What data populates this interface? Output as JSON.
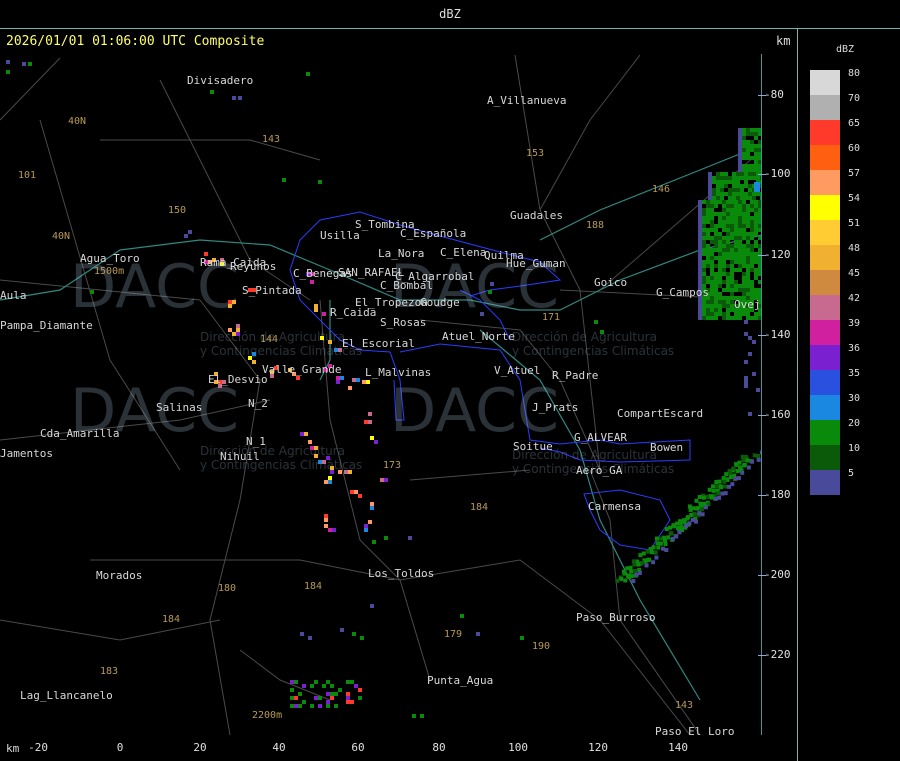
{
  "window_title": "dBZ",
  "header": "2026/01/01 01:06:00 UTC Composite",
  "unit_top": "km",
  "unit_bottom": "km",
  "y_ticks": [
    "-80",
    "-100",
    "-120",
    "-140",
    "-160",
    "-180",
    "-200",
    "-220"
  ],
  "x_ticks": [
    "-20",
    "0",
    "20",
    "40",
    "60",
    "80",
    "100",
    "120",
    "140"
  ],
  "legend": {
    "title": "dBZ",
    "entries": [
      {
        "value": "80",
        "color": "#d8d8d8"
      },
      {
        "value": "70",
        "color": "#b0b0b0"
      },
      {
        "value": "65",
        "color": "#ff3a2a"
      },
      {
        "value": "60",
        "color": "#ff6010"
      },
      {
        "value": "57",
        "color": "#ff9a60"
      },
      {
        "value": "54",
        "color": "#ffff00"
      },
      {
        "value": "51",
        "color": "#ffcc33"
      },
      {
        "value": "48",
        "color": "#f0b030"
      },
      {
        "value": "45",
        "color": "#d08a40"
      },
      {
        "value": "42",
        "color": "#c86a90"
      },
      {
        "value": "39",
        "color": "#d020a0"
      },
      {
        "value": "36",
        "color": "#7a20d0"
      },
      {
        "value": "35",
        "color": "#2a50e0"
      },
      {
        "value": "30",
        "color": "#1a88e0"
      },
      {
        "value": "20",
        "color": "#0a8a0a"
      },
      {
        "value": "10",
        "color": "#0a5a0a"
      },
      {
        "value": "5",
        "color": "#4a4a9a"
      }
    ]
  },
  "watermark": {
    "brand": "DACC",
    "line1": "Dirección de Agricultura",
    "line2": "y Contingencias Climáticas"
  },
  "places": [
    "Divisadero",
    "A_Villanueva",
    "Guadales",
    "Agua_Toro",
    "Pampa_Diamante",
    "Rama_Caida",
    "Reyunos",
    "S_Pintada",
    "Usilla",
    "La_Nora",
    "C_Española",
    "C_Elena",
    "S_Tombina",
    "C_Benegas",
    "SAN_RAFAEL",
    "C_Algarrobal",
    "C_Bombal",
    "Goudge",
    "El_Tropezon",
    "R_Caida",
    "S_Rosas",
    "El_Escorial",
    "Atuel_Norte",
    "Valle_Grande",
    "L_Malvinas",
    "V_Atuel",
    "R_Padre",
    "El_Desvio",
    "Salinas",
    "N_2",
    "J_Prats",
    "CompartEscard",
    "Cda_Amarilla",
    "N_1",
    "Nihuil",
    "Soitue",
    "G_ALVEAR",
    "Bowen",
    "Aero_GA",
    "Carmensa",
    "Morados",
    "Los_Toldos",
    "Paso_Burroso",
    "Lag_Llancanelo",
    "Punta_Agua",
    "Paso_El_Loro",
    "Goico",
    "G_Campos",
    "Ovejero",
    "Aula",
    "Jamentos",
    "Quilma",
    "Hue_Guman"
  ],
  "road_labels": [
    "143",
    "153",
    "146",
    "188",
    "150",
    "101",
    "40N",
    "40N",
    "144",
    "171",
    "173",
    "184",
    "180",
    "184",
    "179",
    "190",
    "183",
    "184",
    "143"
  ],
  "elevation_labels": [
    "1500m",
    "2200m"
  ]
}
